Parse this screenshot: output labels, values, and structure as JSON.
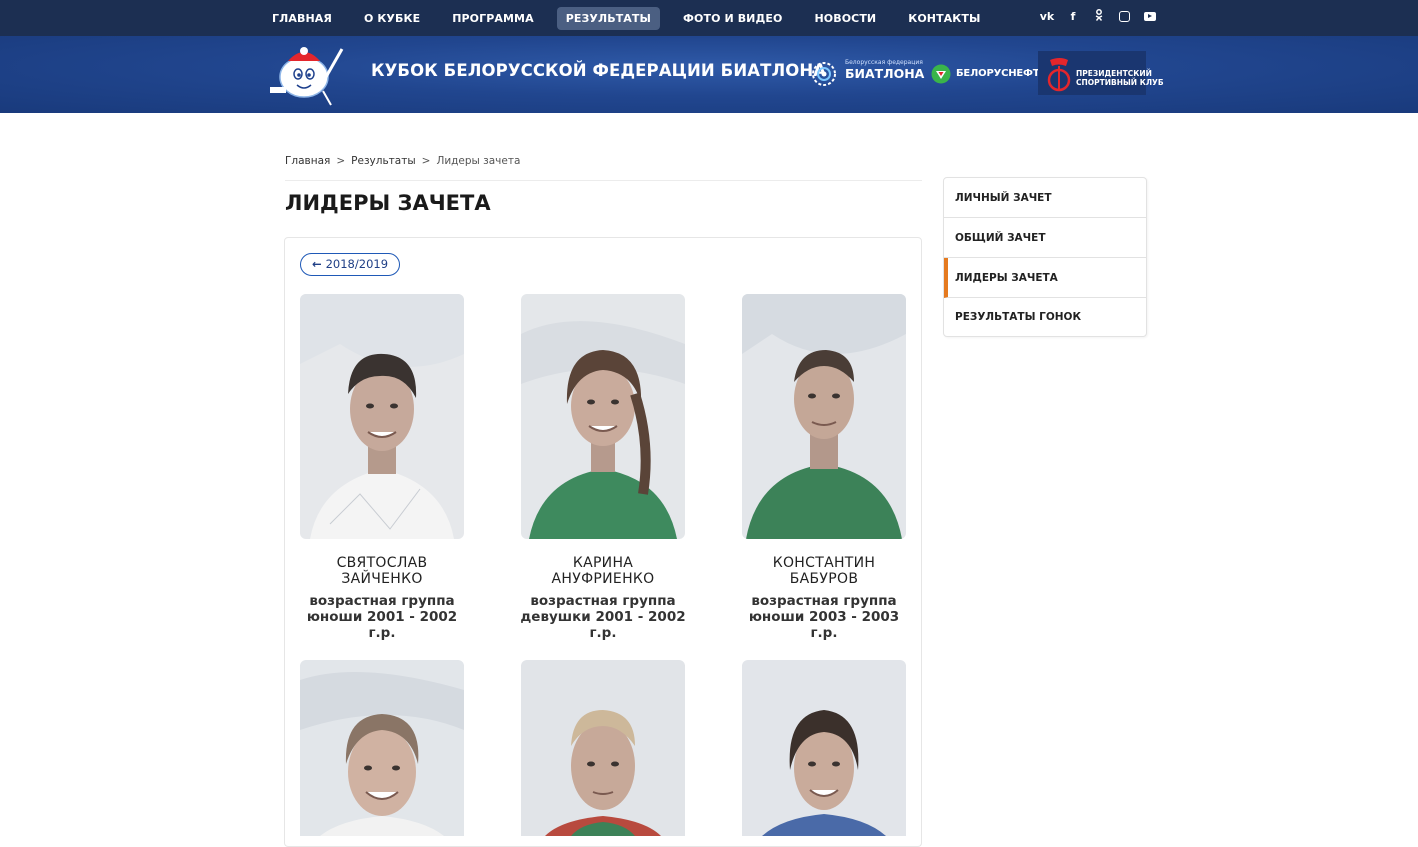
{
  "nav": {
    "items": [
      "ГЛАВНАЯ",
      "О КУБКЕ",
      "ПРОГРАММА",
      "РЕЗУЛЬТАТЫ",
      "ФОТО И ВИДЕО",
      "НОВОСТИ",
      "КОНТАКТЫ"
    ],
    "active": "РЕЗУЛЬТАТЫ"
  },
  "social": {
    "vk_label": "vk",
    "fb_label": "f",
    "ok_label": "ok",
    "icons": [
      "vk-icon",
      "facebook-icon",
      "odnoklassniki-icon",
      "instagram-icon",
      "youtube-icon"
    ]
  },
  "banner": {
    "title": "КУБОК БЕЛОРУССКОЙ ФЕДЕРАЦИИ БИАТЛОНА",
    "federation_small": "Белорусская федерация",
    "federation_big": "БИАТЛОНА",
    "belorusneft": "БЕЛОРУСНЕФТЬ",
    "psk_line1": "ПРЕЗИДЕНТСКИЙ",
    "psk_line2": "СПОРТИВНЫЙ КЛУБ",
    "colors": {
      "topbar": "#1c2f52",
      "banner": "#21468f"
    }
  },
  "breadcrumb": {
    "home": "Главная",
    "results": "Результаты",
    "current": "Лидеры зачета",
    "separator": ">"
  },
  "page": {
    "title": "ЛИДЕРЫ ЗАЧЕТА",
    "season": "2018/2019"
  },
  "leaders": [
    {
      "name_line1": "СВЯТОСЛАВ",
      "name_line2": "ЗАЙЧЕНКО",
      "group_line1": "возрастная группа",
      "group_line2": "юноши 2001 - 2002",
      "group_line3": "г.р."
    },
    {
      "name_line1": "КАРИНА",
      "name_line2": "АНУФРИЕНКО",
      "group_line1": "возрастная группа",
      "group_line2": "девушки 2001 - 2002",
      "group_line3": "г.р."
    },
    {
      "name_line1": "КОНСТАНТИН",
      "name_line2": "БАБУРОВ",
      "group_line1": "возрастная группа",
      "group_line2": "юноши 2003 - 2003",
      "group_line3": "г.р."
    }
  ],
  "sidebar": {
    "items": [
      "ЛИЧНЫЙ ЗАЧЕТ",
      "ОБЩИЙ ЗАЧЕТ",
      "ЛИДЕРЫ ЗАЧЕТА",
      "РЕЗУЛЬТАТЫ ГОНОК"
    ],
    "active": "ЛИДЕРЫ ЗАЧЕТА",
    "accent": "#e57a1f"
  }
}
